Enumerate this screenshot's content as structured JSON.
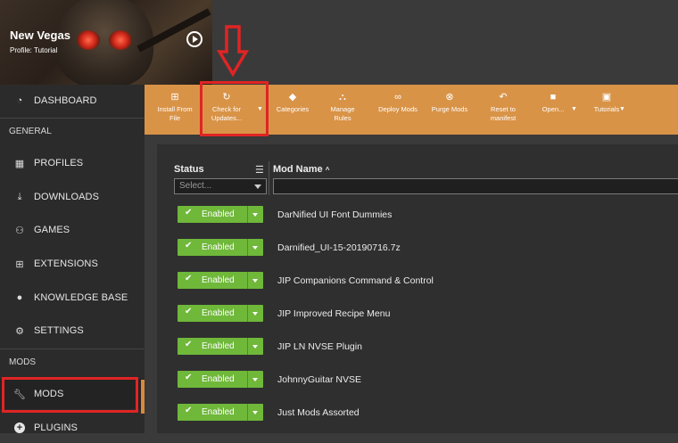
{
  "game": {
    "title": "New Vegas",
    "profile": "Profile: Tutorial"
  },
  "sidebar": {
    "dashboard": "DASHBOARD",
    "section_general": "GENERAL",
    "general_items": [
      "PROFILES",
      "DOWNLOADS",
      "GAMES",
      "EXTENSIONS",
      "KNOWLEDGE BASE",
      "SETTINGS"
    ],
    "section_mods": "MODS",
    "mods_items": [
      "MODS",
      "PLUGINS"
    ]
  },
  "toolbar": {
    "install_from_file": [
      "Install From",
      "File"
    ],
    "check_for_updates": [
      "Check for",
      "Updates..."
    ],
    "categories": "Categories",
    "manage_rules": [
      "Manage",
      "Rules"
    ],
    "deploy_mods": "Deploy Mods",
    "purge_mods": "Purge Mods",
    "reset_to_manifest": [
      "Reset to",
      "manifest"
    ],
    "open": "Open...",
    "tutorials": "Tutorials"
  },
  "table": {
    "status_header": "Status",
    "modname_header": "Mod Name",
    "sort_indicator": "^",
    "status_filter_placeholder": "Select...",
    "rows": [
      {
        "status": "Enabled",
        "name": "DarNified UI Font Dummies"
      },
      {
        "status": "Enabled",
        "name": "Darnified_UI-15-20190716.7z"
      },
      {
        "status": "Enabled",
        "name": "JIP Companions Command & Control"
      },
      {
        "status": "Enabled",
        "name": "JIP Improved Recipe Menu"
      },
      {
        "status": "Enabled",
        "name": "JIP LN NVSE Plugin"
      },
      {
        "status": "Enabled",
        "name": "JohnnyGuitar NVSE"
      },
      {
        "status": "Enabled",
        "name": "Just Mods Assorted"
      }
    ]
  },
  "colors": {
    "toolbar_orange": "#d99347",
    "enabled_green": "#6fb83a",
    "highlight_red": "#e02424",
    "sidebar_bg": "#2b2b2b"
  }
}
